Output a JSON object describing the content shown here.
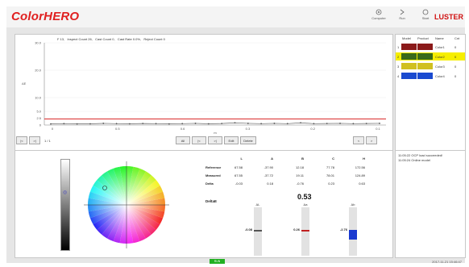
{
  "app": {
    "title": "ColorHERO",
    "brand": "LUSTER"
  },
  "header": {
    "buttons": [
      {
        "label": "Computer",
        "icon": "computer-icon"
      },
      {
        "label": "Run",
        "icon": "run-icon"
      },
      {
        "label": "Start",
        "icon": "start-icon"
      }
    ]
  },
  "chart": {
    "info": "F 13,   Inspect Count 26,   Cast Count 0,   Cast Rate 0.0%,   Reject Count 0",
    "ylabel": "ΔE",
    "yticks": [
      "30.0",
      "20.0",
      "10.0",
      "5.0",
      "2.5",
      "0"
    ],
    "xticks": [
      "0",
      "0.5",
      "0.6",
      "0.3",
      "0.2",
      "0.1"
    ],
    "xlabel": "m"
  },
  "chart_data": {
    "type": "line",
    "threshold": 2.2,
    "ylim": [
      0,
      30
    ],
    "x": [
      0,
      1,
      2,
      3,
      4,
      5,
      6,
      7,
      8,
      9,
      10,
      11,
      12,
      13,
      14,
      15,
      16,
      17,
      18,
      19,
      20,
      21,
      22,
      23,
      24,
      25
    ],
    "series": [
      {
        "values": [
          0.4,
          0.5,
          0.4,
          0.45,
          0.6,
          0.5,
          0.45,
          0.55,
          0.5,
          0.4,
          0.5,
          0.6,
          0.45,
          0.55,
          0.8,
          0.6,
          0.5,
          0.6,
          0.5,
          0.8,
          0.5,
          0.55,
          0.6,
          0.5,
          0.55,
          0.6
        ]
      }
    ]
  },
  "nav": {
    "page": "1 / 1",
    "buttons": [
      "All",
      "|<",
      ">|",
      "Edit",
      "Delete"
    ],
    "prev": "<",
    "next": ">"
  },
  "products": {
    "headers": [
      "Model",
      "Product",
      "Name",
      "Cnt"
    ],
    "rows": [
      {
        "idx": "1",
        "c1": "#8b1a1a",
        "c2": "#8b1a1a",
        "name": "Color1",
        "cnt": "0",
        "hl": false
      },
      {
        "idx": "2",
        "c1": "#3a6b1a",
        "c2": "#3a6b1a",
        "name": "Color2",
        "cnt": "0",
        "hl": true
      },
      {
        "idx": "3",
        "c1": "#d0c020",
        "c2": "#d0c020",
        "name": "Color3",
        "cnt": "0",
        "hl": false
      },
      {
        "idx": "4",
        "c1": "#1a4ad0",
        "c2": "#1a4ad0",
        "name": "Color4",
        "cnt": "0",
        "hl": false
      }
    ]
  },
  "measure": {
    "columns": [
      "L",
      "A",
      "B",
      "C",
      "H"
    ],
    "rows": [
      {
        "label": "Reference",
        "values": [
          "67.58",
          "-37.90",
          "12.18",
          "77.78",
          "172.56"
        ]
      },
      {
        "label": "Measured",
        "values": [
          "67.55",
          "-37.72",
          "19.11",
          "78.01",
          "124.89"
        ]
      },
      {
        "label": "Delta",
        "values": [
          "-0.03",
          "0.18",
          "-0.76",
          "0.23",
          "0.63"
        ]
      }
    ],
    "delta_label": "DeltaE",
    "delta_value": "0.53",
    "bars": [
      {
        "label": "ΔL",
        "value": "-0.08"
      },
      {
        "label": "Δa",
        "value": "0.26"
      },
      {
        "label": "Δb",
        "value": "-2.76"
      }
    ]
  },
  "log": [
    "11:05:22  OCP load succeeded!",
    "11:05:24  Online model"
  ],
  "status": {
    "indicator": "RUN",
    "clock": "2017-11-21  15:46:47"
  }
}
